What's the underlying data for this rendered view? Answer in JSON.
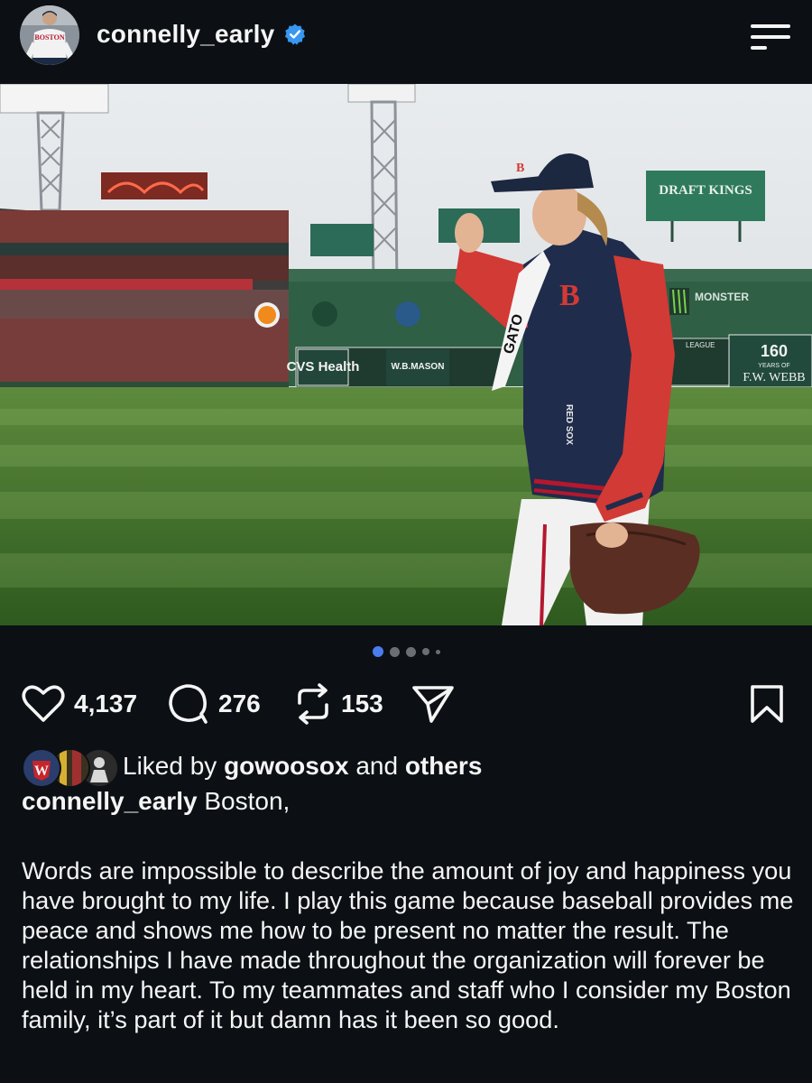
{
  "header": {
    "username": "connelly_early",
    "avatar_jersey_text": "BOSTON",
    "verified_icon": "verified-badge-icon",
    "menu_icon": "menu-icon"
  },
  "photo": {
    "scoreboard_sponsor": "CVS Health",
    "wall_sponsor": "W.B.MASON",
    "right_sign_line1": "160",
    "right_sign_line2": "YEARS OF",
    "right_sign_line3": "F.W. WEBB",
    "billboard_draftkings": "DRAFT KINGS",
    "billboard_monster": "MONSTER",
    "jacket_text": "RED SOX",
    "towel_text": "GATO",
    "cap_letter": "B",
    "league_label": "LEAGUE"
  },
  "carousel": {
    "total_dots": 5,
    "active_index": 0
  },
  "actions": {
    "likes": "4,137",
    "comments": "276",
    "reposts": "153"
  },
  "liked_by": {
    "prefix": "Liked by",
    "user": "gowoosox",
    "middle": "and",
    "suffix": "others",
    "face1_letter": "W"
  },
  "caption": {
    "username": "connelly_early",
    "first_line": "Boston,",
    "body": "Words are impossible to describe the amount of joy and happiness you have brought to my life. I play this game because baseball provides me peace and shows me how to be present no matter the result. The relationships I have made throughout the organization will forever be held in my heart. To my teammates and staff who I consider my Boston family, it’s part of it but damn has it been so good."
  },
  "colors": {
    "background": "#0c1014",
    "text": "#f5f5f5",
    "verified": "#3897f0",
    "active_dot": "#4a7cf0",
    "inactive_dot": "#6b6f74"
  }
}
